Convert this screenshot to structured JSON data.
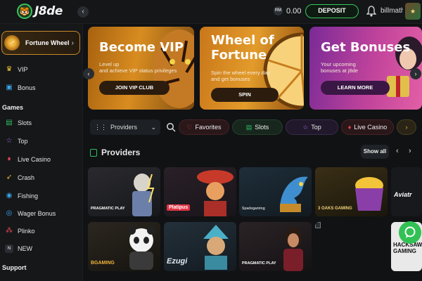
{
  "header": {
    "logo_text": "J8de",
    "balance": "0.00",
    "currency_badge": "RM",
    "deposit_label": "DEPOSIT",
    "username": "billmathe..."
  },
  "sidebar": {
    "featured": {
      "label": "Fortune Wheel"
    },
    "top_items": [
      {
        "label": "VIP",
        "icon": "crown-icon"
      },
      {
        "label": "Bonus",
        "icon": "gift-icon"
      }
    ],
    "games_heading": "Games",
    "game_items": [
      {
        "label": "Slots",
        "icon": "slots-icon"
      },
      {
        "label": "Top",
        "icon": "star-icon"
      },
      {
        "label": "Live Casino",
        "icon": "cards-icon"
      },
      {
        "label": "Crash",
        "icon": "rocket-icon"
      },
      {
        "label": "Fishing",
        "icon": "fish-icon"
      },
      {
        "label": "Wager Bonus",
        "icon": "coins-icon"
      },
      {
        "label": "Plinko",
        "icon": "plinko-icon"
      },
      {
        "label": "NEW",
        "icon": "new-icon"
      }
    ],
    "support_heading": "Support"
  },
  "banners": [
    {
      "title": "Become VIP",
      "subtitle_1": "Level up",
      "subtitle_2": "and achieve VIP status privileges",
      "button": "JOIN VIP CLUB"
    },
    {
      "title_1": "Wheel of",
      "title_2": "Fortune",
      "subtitle_1": "Spin the wheel every day",
      "subtitle_2": "and get bonuses",
      "button": "SPIN"
    },
    {
      "title": "Get Bonuses",
      "subtitle_1": "Your upcoming",
      "subtitle_2": "bonuses at j8de",
      "button": "LEARN MORE"
    }
  ],
  "filters": {
    "providers_select": "Providers",
    "pills": [
      {
        "label": "Favorites",
        "icon": "heart-icon",
        "color": "#e0464f"
      },
      {
        "label": "Slots",
        "icon": "slots-icon",
        "color": "#2fbf5f"
      },
      {
        "label": "Top",
        "icon": "star-icon",
        "color": "#a66be8"
      },
      {
        "label": "Live Casino",
        "icon": "cards-icon",
        "color": "#e0464f"
      }
    ]
  },
  "providers": {
    "heading": "Providers",
    "show_all": "Show all",
    "row1": [
      "PRAGMATIC PLAY",
      "Platipus",
      "Spadegaming",
      "3 OAKS GAMING",
      "Aviatr"
    ],
    "row2": [
      "BGAMING",
      "Ezugi",
      "PRAGMATIC PLAY",
      "",
      "HACKSAW GAMING"
    ]
  },
  "colors": {
    "accent_green": "#37c95b",
    "gold": "#c88a2a",
    "bg": "#101214"
  }
}
